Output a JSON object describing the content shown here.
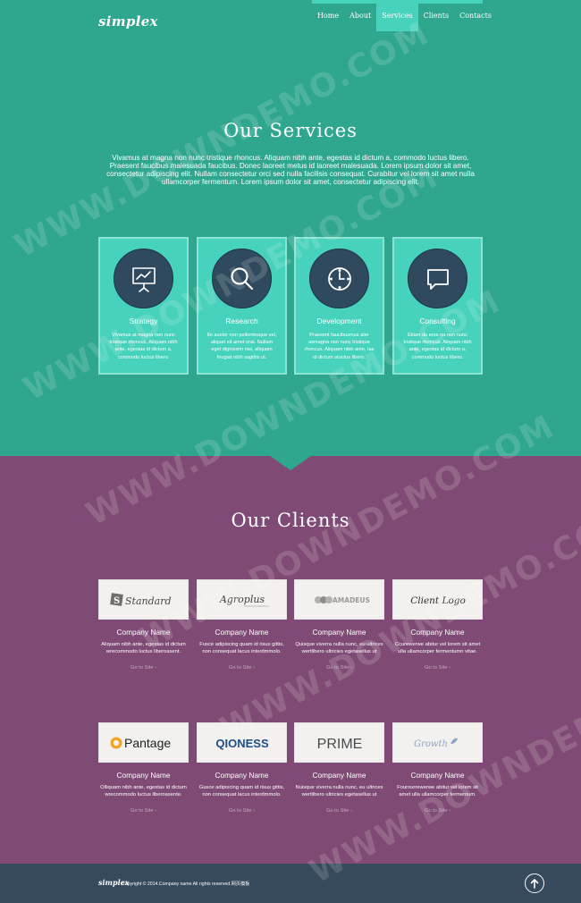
{
  "brand": {
    "logo": "simplex"
  },
  "nav": {
    "items": [
      {
        "label": "Home",
        "active": false
      },
      {
        "label": "About",
        "active": false
      },
      {
        "label": "Services",
        "active": true
      },
      {
        "label": "Clients",
        "active": false
      },
      {
        "label": "Contacts",
        "active": false
      }
    ]
  },
  "services": {
    "title": "Our Services",
    "intro": "Vivamus at magna non nunc tristique rhoncus. Aliquam nibh ante, egestas id dictum a, commodo luctus libero. Praesent faucibus malesuada faucibus. Donec laoreet metus id laoreet malesuada. Lorem ipsum dolor sit amet, consectetur adipiscing elit. Nullam consectetur orci sed nulla facilisis consequat. Curabitur vel lorem sit amet nulla ullamcorper fermentum. Lorem ipsum dolor sit amet, consectetur adipiscing elit.",
    "items": [
      {
        "name": "Strategy",
        "icon": "presentation-chart-icon",
        "desc": "Vivamus at magna non nunc tristique rhoncus. Aliquam nibh ante, egestas id dictum a, commodo luctus libero."
      },
      {
        "name": "Research",
        "icon": "magnifier-icon",
        "desc": "Ite auctor non pellentesque vel, aliquet sit amet erat. Nullam eget dignissim nisi, aliquam feugiat nibh sagittis ut."
      },
      {
        "name": "Development",
        "icon": "clock-icon",
        "desc": "Praesent faucibusmus ater asmagna non nunc tristique rhoncus. Aliquam nibh ante, tas id dictum atuctus libero."
      },
      {
        "name": "Consulting",
        "icon": "speech-bubble-icon",
        "desc": "Etiam du eros na non nunc tristique rhoncus. Aliquam nibh ante, egestas id dictum a, commodo luctus libero."
      }
    ]
  },
  "clients": {
    "title": "Our Clients",
    "items": [
      {
        "logo": "Standard",
        "name": "Company Name",
        "desc": "Aliquam nibh ante, egestas id dictum wrecommodo luctus liberoasent.",
        "link": "Go to Site ›"
      },
      {
        "logo": "Agroplus",
        "name": "Company Name",
        "desc": "Fusce adipiscing quam id risus gittis, non consequat lacus interdmmolo.",
        "link": "Go to Site ›"
      },
      {
        "logo": "AMADEUS",
        "name": "Company Name",
        "desc": "Quisque viverra nulla nunc, eu ultrices wertlibero ultricies egetasellus ut",
        "link": "Go to Site ›"
      },
      {
        "logo": "Client Logo",
        "name": "Company Name",
        "desc": "Ccurewerwe abitur vel lorem sit amet ulla ullamcorper fermentumn vitae.",
        "link": "Go to Site ›"
      },
      {
        "logo": "Pantage",
        "name": "Company Name",
        "desc": "Olliquam nibh ante, egestas id dictum wrecommodo luctus liberoasente.",
        "link": "Go to Site ›"
      },
      {
        "logo": "QIONESS",
        "name": "Company Name",
        "desc": "Gusce adipiscing quam id risus gittis, non consequat lacus interdmmolo.",
        "link": "Go to Site ›"
      },
      {
        "logo": "PRIME",
        "name": "Company Name",
        "desc": "Nuisque viverra nulla nunc, eu ultrices wertlibero ultricies egetasellus ut",
        "link": "Go to Site ›"
      },
      {
        "logo": "Growth",
        "name": "Company Name",
        "desc": "Fourourrewerwe abitur vel lorem sit amet ulla ullamcorper fermentum.",
        "link": "Go to Site ›"
      }
    ]
  },
  "footer": {
    "logo": "simplex",
    "copyright": "Copyright © 2014.Company name All rights reserved.网页模板",
    "to_top_icon": "arrow-up-circle-icon"
  },
  "watermark": "WWW.DOWNDEMO.COM",
  "colors": {
    "teal": "#2fa68e",
    "teal_light": "#46d2bc",
    "plum": "#7f4a75",
    "navy": "#36495d"
  }
}
